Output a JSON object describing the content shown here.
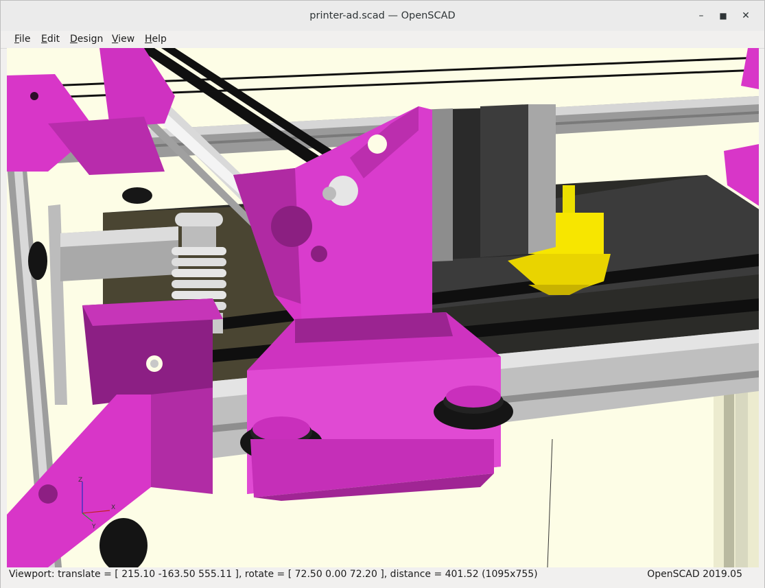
{
  "window": {
    "title": "printer-ad.scad — OpenSCAD",
    "controls": {
      "minimize_icon": "minimize-icon",
      "maximize_icon": "maximize-icon",
      "close_icon": "close-icon",
      "minimize_glyph": "–",
      "maximize_glyph": "■",
      "close_glyph": "✕"
    }
  },
  "menubar": {
    "items": [
      {
        "mnemonic": "F",
        "rest": "ile"
      },
      {
        "mnemonic": "E",
        "rest": "dit"
      },
      {
        "mnemonic": "D",
        "rest": "esign"
      },
      {
        "mnemonic": "V",
        "rest": "iew"
      },
      {
        "mnemonic": "H",
        "rest": "elp"
      }
    ]
  },
  "viewport": {
    "background_color": "#fdfde6",
    "part_color": "#d836c8",
    "rail_color": "#c7c7c7",
    "model_color": "#f0e000",
    "axes": {
      "x": "X",
      "y": "Y",
      "z": "Z"
    }
  },
  "status": {
    "viewport_info": "Viewport: translate = [ 215.10 -163.50 555.11 ], rotate = [ 72.50 0.00 72.20 ], distance = 401.52 (1095x755)",
    "version": "OpenSCAD 2019.05"
  }
}
